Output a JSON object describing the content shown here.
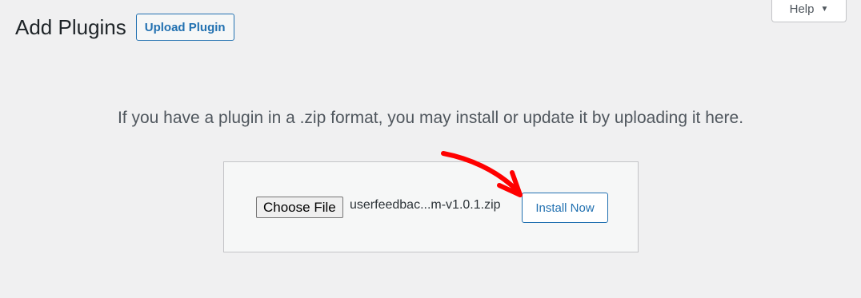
{
  "header": {
    "title": "Add Plugins",
    "upload_button_label": "Upload Plugin",
    "help_label": "Help",
    "help_caret": "▼"
  },
  "main": {
    "intro": "If you have a plugin in a .zip format, you may install or update it by uploading it here.",
    "choose_file_label": "Choose File",
    "file_name": "userfeedbac...m-v1.0.1.zip",
    "install_button_label": "Install Now"
  },
  "colors": {
    "background": "#f0f0f1",
    "accent": "#2271b1",
    "annotation": "#ff0000"
  },
  "icons": {
    "help_caret": "caret-down-icon",
    "annotation": "red-arrow-icon"
  }
}
